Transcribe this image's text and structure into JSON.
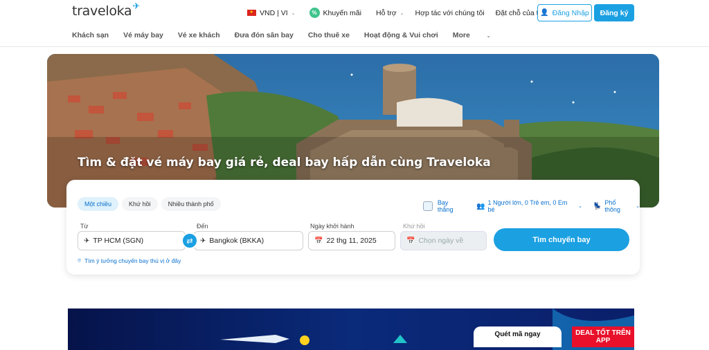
{
  "brand": {
    "logo_text": "traveloka"
  },
  "header": {
    "currency_lang": "VND | VI",
    "promo": "Khuyến mãi",
    "support": "Hỗ trợ",
    "partner": "Hợp tác với chúng tôi",
    "bookings": "Đặt chỗ của tôi",
    "login": "Đăng Nhập",
    "register": "Đăng ký"
  },
  "nav": {
    "items": [
      "Khách sạn",
      "Vé máy bay",
      "Vé xe khách",
      "Đưa đón sân bay",
      "Cho thuê xe",
      "Hoạt động & Vui chơi"
    ],
    "more": "More"
  },
  "hero": {
    "title": "Tìm & đặt vé máy bay giá rẻ, deal bay hấp dẫn cùng Traveloka"
  },
  "search": {
    "trip_types": [
      "Một chiều",
      "Khứ hồi",
      "Nhiều thành phố"
    ],
    "active_trip_type": "Một chiều",
    "direct_flight": "Bay thẳng",
    "passengers": "1 Người lớn, 0 Trẻ em, 0 Em bé",
    "cabin_class": "Phổ thông",
    "from_label": "Từ",
    "from_value": "TP HCM (SGN)",
    "to_label": "Đến",
    "to_value": "Bangkok (BKKA)",
    "depart_label": "Ngày khởi hành",
    "depart_value": "22 thg 11, 2025",
    "return_label": "Khứ hồi",
    "return_placeholder": "Chọn ngày về",
    "search_button": "Tìm chuyến bay",
    "explore_link": "Tìm ý tưởng chuyến bay thú vị ở đây"
  },
  "promo_banner": {
    "qr_label": "Quét mã ngay",
    "deal_label": "DEAL TỐT TRÊN APP"
  },
  "colors": {
    "accent": "#1ba0e2",
    "link": "#0770cd",
    "deal_red": "#e8102a"
  }
}
